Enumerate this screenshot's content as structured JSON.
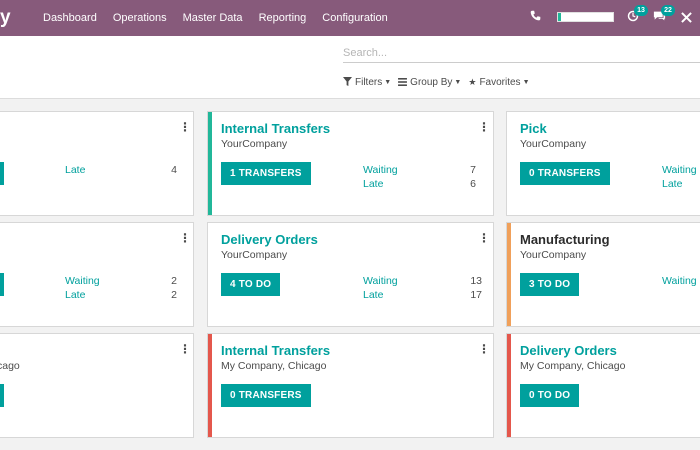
{
  "nav": {
    "brand": "y",
    "menu": [
      "Dashboard",
      "Operations",
      "Master Data",
      "Reporting",
      "Configuration"
    ],
    "activity_badge": "13",
    "chat_badge": "22",
    "progress": 0.05,
    "icons": {
      "phone": "phone-icon",
      "activity": "clock-icon",
      "chat": "chat-icon",
      "close": "close-icon"
    }
  },
  "search": {
    "placeholder": "Search...",
    "value": ""
  },
  "filters": {
    "filters": "Filters",
    "group_by": "Group By",
    "favorites": "Favorites"
  },
  "cards": [
    {
      "company": "",
      "stats": [
        {
          "label": "Late",
          "value": "4"
        }
      ]
    },
    {
      "title": "Internal Transfers",
      "company": "YourCompany",
      "button": "1 TRANSFERS",
      "stats": [
        {
          "label": "Waiting",
          "value": "7"
        },
        {
          "label": "Late",
          "value": "6"
        }
      ]
    },
    {
      "title": "Pick",
      "company": "YourCompany",
      "button": "0 TRANSFERS",
      "stats": [
        {
          "label": "Waiting"
        },
        {
          "label": "Late"
        }
      ]
    },
    {
      "stats": [
        {
          "label": "Waiting",
          "value": "2"
        },
        {
          "label": "Late",
          "value": "2"
        }
      ]
    },
    {
      "title": "Delivery Orders",
      "company": "YourCompany",
      "button": "4 TO DO",
      "stats": [
        {
          "label": "Waiting",
          "value": "13"
        },
        {
          "label": "Late",
          "value": "17"
        }
      ]
    },
    {
      "title": "Manufacturing",
      "company": "YourCompany",
      "button": "3 TO DO",
      "stats": [
        {
          "label": "Waiting"
        }
      ]
    },
    {
      "company": "cago"
    },
    {
      "title": "Internal Transfers",
      "company": "My Company, Chicago",
      "button": "0 TRANSFERS"
    },
    {
      "title": "Delivery Orders",
      "company": "My Company, Chicago",
      "button": "0 TO DO"
    }
  ],
  "colors": {
    "navbar": "#875a7b",
    "primary": "#00a09d",
    "accent_green": "#21b799",
    "accent_orange": "#f0a05a",
    "accent_red": "#e4574c"
  }
}
